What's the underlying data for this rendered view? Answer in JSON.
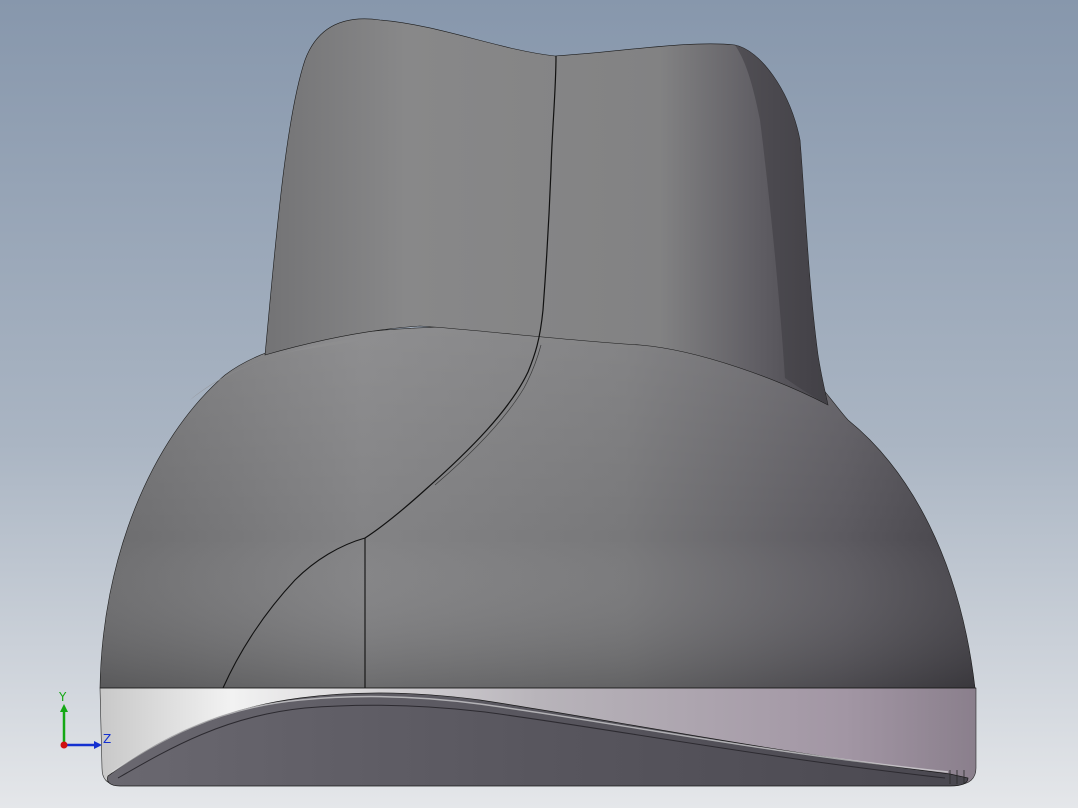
{
  "viewport": {
    "background_top": "#8a9bb0",
    "background_bottom": "#e4e6ea",
    "model_body_color": "#7e7e80",
    "model_shadow_color": "#4e4c52",
    "model_edge_color": "#141414",
    "base_band_left": "#f0f0f0",
    "base_band_right": "#8a7f8c"
  },
  "triad": {
    "x_axis_color": "#d01010",
    "y_axis_color": "#10b010",
    "z_axis_color": "#1030d0",
    "y_label": "Y",
    "z_label": "Z"
  }
}
